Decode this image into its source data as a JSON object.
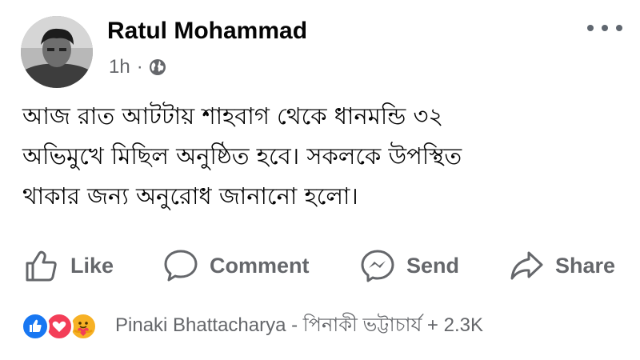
{
  "post": {
    "author": "Ratul Mohammad",
    "time": "1h",
    "separator": "·",
    "privacy_icon": "globe-icon",
    "more_icon": "ellipsis-icon",
    "text": "আজ রাত আটটায় শাহবাগ থেকে ধানমন্ডি ৩২\nঅভিমুখে মিছিল অনুষ্ঠিত হবে। সকলকে উপস্থিত\nথাকার জন্য অনুরোধ জানানো হলো।"
  },
  "actions": [
    {
      "label": "Like",
      "icon": "thumbs-up-icon"
    },
    {
      "label": "Comment",
      "icon": "comment-bubble-icon"
    },
    {
      "label": "Send",
      "icon": "messenger-icon"
    },
    {
      "label": "Share",
      "icon": "share-arrow-icon"
    }
  ],
  "reactions": {
    "icons": [
      "like-reaction-icon",
      "love-reaction-icon",
      "care-reaction-icon"
    ],
    "summary": "Pinaki Bhattacharya - পিনাকী ভট্টাচার্য + 2.3K"
  },
  "colors": {
    "text_primary": "#050505",
    "text_secondary": "#65676b",
    "like_blue": "#1877f2",
    "love_red": "#f33e58",
    "care_yellow": "#f7b125"
  }
}
